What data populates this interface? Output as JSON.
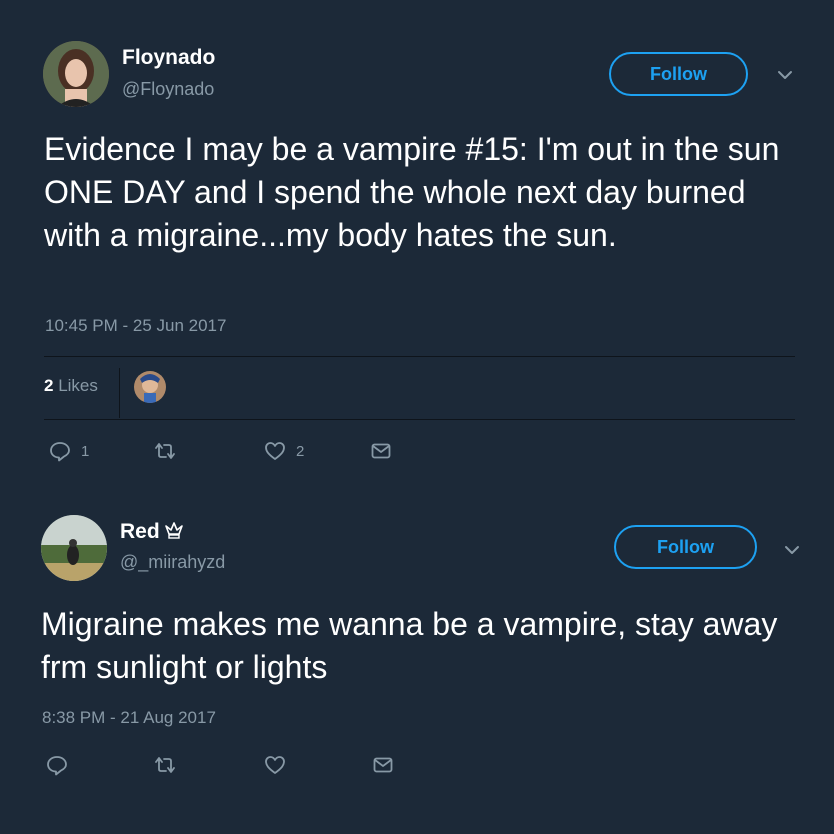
{
  "tweets": [
    {
      "display_name": "Floynado",
      "handle": "@Floynado",
      "follow_label": "Follow",
      "text": "Evidence I may be a vampire #15: I'm out in the sun ONE DAY and I spend the whole next day burned with a migraine...my body hates the sun.",
      "timestamp": "10:45 PM - 25 Jun 2017",
      "likes_count": "2",
      "likes_label": "Likes",
      "reply_count": "1",
      "like_count": "2"
    },
    {
      "display_name": "Red",
      "handle": "@_miirahyzd",
      "follow_label": "Follow",
      "text": "Migraine makes me wanna be a vampire, stay away frm sunlight or lights",
      "timestamp": "8:38 PM - 21 Aug 2017"
    }
  ],
  "colors": {
    "background": "#1c2938",
    "accent": "#1da1f2",
    "secondary_text": "#8899a6"
  }
}
